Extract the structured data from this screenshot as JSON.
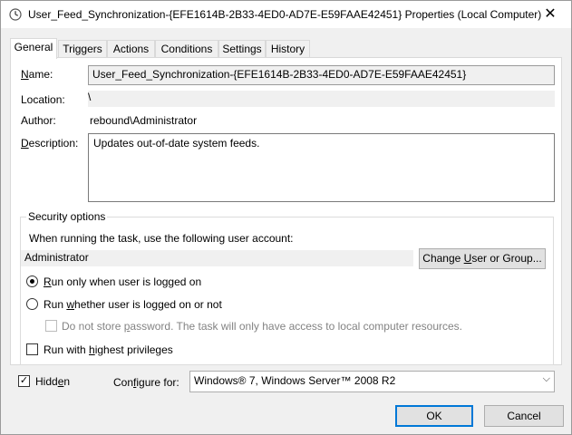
{
  "window": {
    "title": "User_Feed_Synchronization-{EFE1614B-2B33-4ED0-AD7E-E59FAAE42451} Properties (Local Computer)",
    "close_glyph": "✕"
  },
  "tabs": [
    {
      "label": "General",
      "active": true
    },
    {
      "label": "Triggers"
    },
    {
      "label": "Actions"
    },
    {
      "label": "Conditions"
    },
    {
      "label": "Settings"
    },
    {
      "label": "History"
    }
  ],
  "general": {
    "name_label_key": "N",
    "name_label_rest": "ame:",
    "name_value": "User_Feed_Synchronization-{EFE1614B-2B33-4ED0-AD7E-E59FAAE42451}",
    "location_label": "Location:",
    "location_value": "\\",
    "author_label": "Author:",
    "author_value": "rebound\\Administrator",
    "description_label_key": "D",
    "description_label_rest": "escription:",
    "description_value": "Updates out-of-date system feeds."
  },
  "security": {
    "group_title": "Security options",
    "account_prompt": "When running the task, use the following user account:",
    "account_value": "Administrator",
    "change_user_button_pre": "Change ",
    "change_user_button_key": "U",
    "change_user_button_post": "ser or Group...",
    "radio_logged_on_key": "R",
    "radio_logged_on_rest": "un only when user is logged on",
    "radio_logged_on_selected": true,
    "radio_whether_pre": "Run ",
    "radio_whether_key": "w",
    "radio_whether_post": "hether user is logged on or not",
    "radio_whether_selected": false,
    "no_store_pwd_pre": "Do not store ",
    "no_store_pwd_key": "p",
    "no_store_pwd_post": "assword.  The task will only have access to local computer resources.",
    "highest_priv_pre": "Run with ",
    "highest_priv_key": "h",
    "highest_priv_post": "ighest privileges"
  },
  "bottom": {
    "hidden_pre": "Hidd",
    "hidden_key": "e",
    "hidden_post": "n",
    "hidden_checked": true,
    "check_glyph": "✓",
    "configure_pre": "Con",
    "configure_key": "f",
    "configure_post": "igure for:",
    "configure_value": "Windows® 7, Windows Server™ 2008 R2",
    "dropdown_glyph": "⌵",
    "ok_label": "OK",
    "cancel_label": "Cancel"
  },
  "icons": {
    "title_icon": "clock-icon"
  }
}
